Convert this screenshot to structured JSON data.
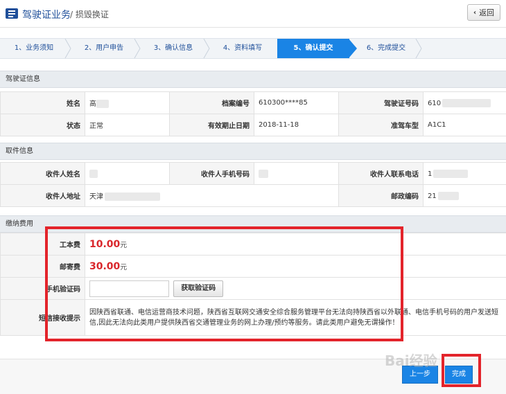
{
  "header": {
    "title": "驾驶证业务",
    "subtitle": "/ 损毁换证",
    "back_label": "返回"
  },
  "steps": [
    {
      "label": "1、业务须知",
      "active": false
    },
    {
      "label": "2、用户申告",
      "active": false
    },
    {
      "label": "3、确认信息",
      "active": false
    },
    {
      "label": "4、资料填写",
      "active": false
    },
    {
      "label": "5、确认提交",
      "active": true
    },
    {
      "label": "6、完成提交",
      "active": false
    }
  ],
  "license_info": {
    "heading": "驾驶证信息",
    "name_label": "姓名",
    "name_value": "高",
    "file_no_label": "档案编号",
    "file_no_value": "610300****85",
    "license_no_label": "驾驶证号码",
    "license_no_value": "610",
    "status_label": "状态",
    "status_value": "正常",
    "expiry_label": "有效期止日期",
    "expiry_value": "2018-11-18",
    "vehicle_type_label": "准驾车型",
    "vehicle_type_value": "A1C1"
  },
  "pickup_info": {
    "heading": "取件信息",
    "recipient_name_label": "收件人姓名",
    "recipient_phone_label": "收件人手机号码",
    "recipient_contact_label": "收件人联系电话",
    "recipient_contact_value": "1",
    "address_label": "收件人地址",
    "address_value": "天津",
    "postcode_label": "邮政编码",
    "postcode_value": "21"
  },
  "fees": {
    "heading": "缴纳费用",
    "production_fee_label": "工本费",
    "production_fee_value": "10.00",
    "postage_label": "邮寄费",
    "postage_value": "30.00",
    "currency_unit": "元",
    "sms_code_label": "手机验证码",
    "sms_code_value": "",
    "get_code_label": "获取验证码",
    "sms_notice_label": "短信接收提示",
    "sms_notice_text": "因陕西省联通、电信运营商技术问题，陕西省互联网交通安全综合服务管理平台无法向持陕西省以外联通、电信手机号码的用户发送短信,因此无法向此类用户提供陕西省交通管理业务的网上办理/预约等服务。请此类用户避免无谓操作！"
  },
  "footer": {
    "prev_label": "上一步",
    "finish_label": "完成"
  },
  "watermark": "Bai经验",
  "colors": {
    "brand_blue": "#1f4f9a",
    "active_step": "#1a84e5",
    "fee_red": "#d9262b",
    "highlight_red": "#e3242b"
  }
}
